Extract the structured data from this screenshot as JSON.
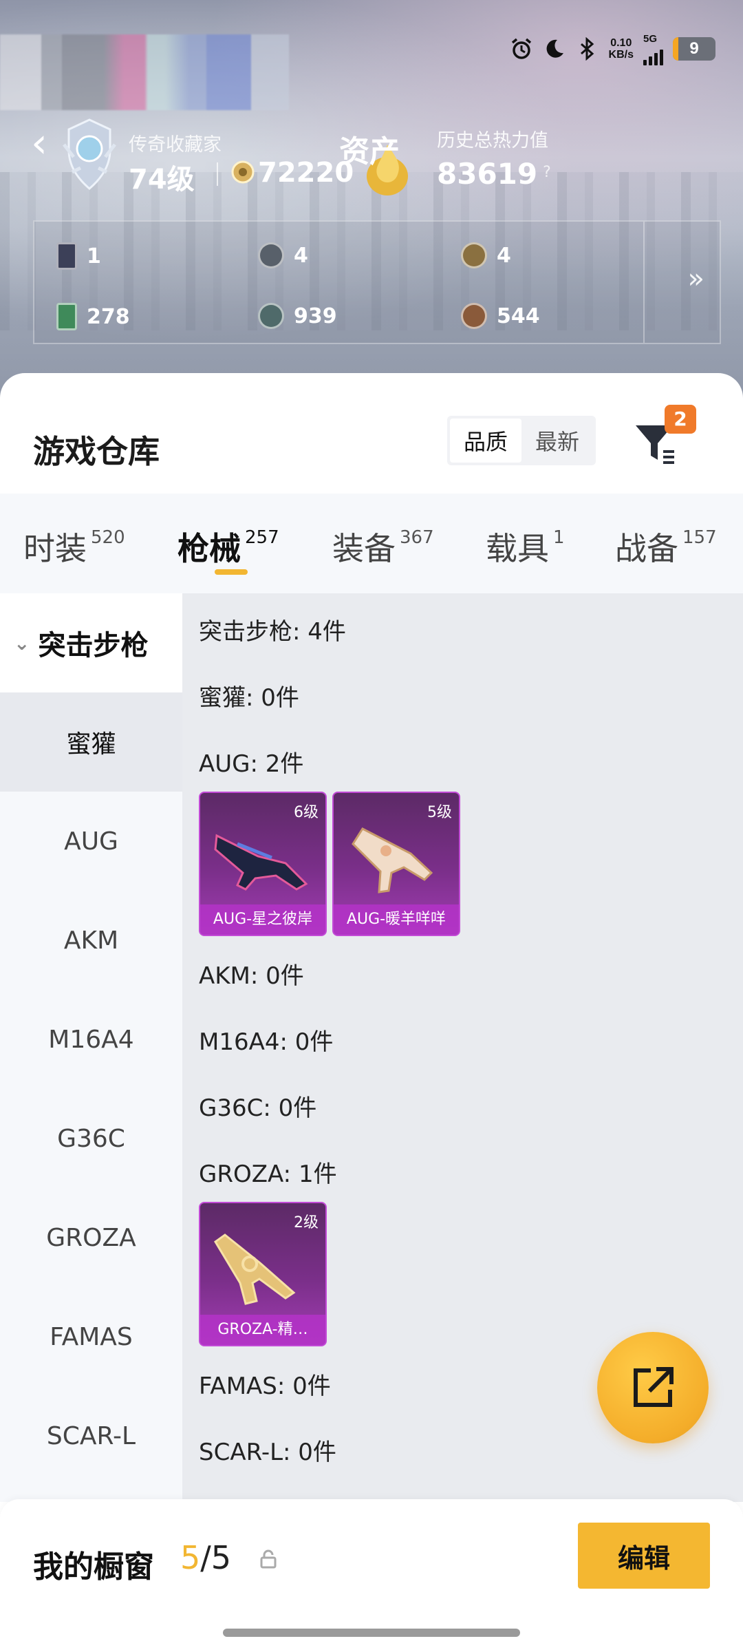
{
  "status": {
    "net_speed": "0.10",
    "net_unit": "KB/s",
    "network": "5G",
    "battery": "9"
  },
  "profile": {
    "rank_title": "传奇收藏家",
    "level": "74级",
    "coins": "72220",
    "asset_label": "资产",
    "heat_label": "历史总热力值",
    "heat_value": "83619",
    "help": "?"
  },
  "stats": [
    {
      "icon": "card-icon",
      "value": "1"
    },
    {
      "icon": "silver-medal-icon",
      "value": "4"
    },
    {
      "icon": "gold-medal-icon",
      "value": "4"
    },
    {
      "icon": "green-ticket-icon",
      "value": "278"
    },
    {
      "icon": "teal-coin-icon",
      "value": "939"
    },
    {
      "icon": "bronze-coin-icon",
      "value": "544"
    }
  ],
  "warehouse": {
    "title": "游戏仓库",
    "sort_quality": "品质",
    "sort_newest": "最新",
    "filter_badge": "2"
  },
  "tabs": [
    {
      "label": "时装",
      "count": "520"
    },
    {
      "label": "枪械",
      "count": "257"
    },
    {
      "label": "装备",
      "count": "367"
    },
    {
      "label": "载具",
      "count": "1"
    },
    {
      "label": "战备",
      "count": "157"
    }
  ],
  "sidebar": {
    "group": "突击步枪",
    "items": [
      "蜜獾",
      "AUG",
      "AKM",
      "M16A4",
      "G36C",
      "GROZA",
      "FAMAS",
      "SCAR-L"
    ]
  },
  "content": {
    "rows": [
      "突击步枪: 4件",
      "蜜獾: 0件",
      "AUG: 2件",
      "AKM: 0件",
      "M16A4: 0件",
      "G36C: 0件",
      "GROZA: 1件",
      "FAMAS: 0件",
      "SCAR-L: 0件"
    ],
    "cards": [
      {
        "level": "6级",
        "name": "AUG-星之彼岸"
      },
      {
        "level": "5级",
        "name": "AUG-暖羊咩咩"
      },
      {
        "level": "2级",
        "name": "GROZA-精…"
      }
    ]
  },
  "footer": {
    "label": "我的橱窗",
    "used": "5",
    "total": "/5",
    "edit": "编辑"
  },
  "colors": {
    "accent": "#f4b731",
    "card": "#7b2f8a",
    "badge": "#f07a2a"
  }
}
